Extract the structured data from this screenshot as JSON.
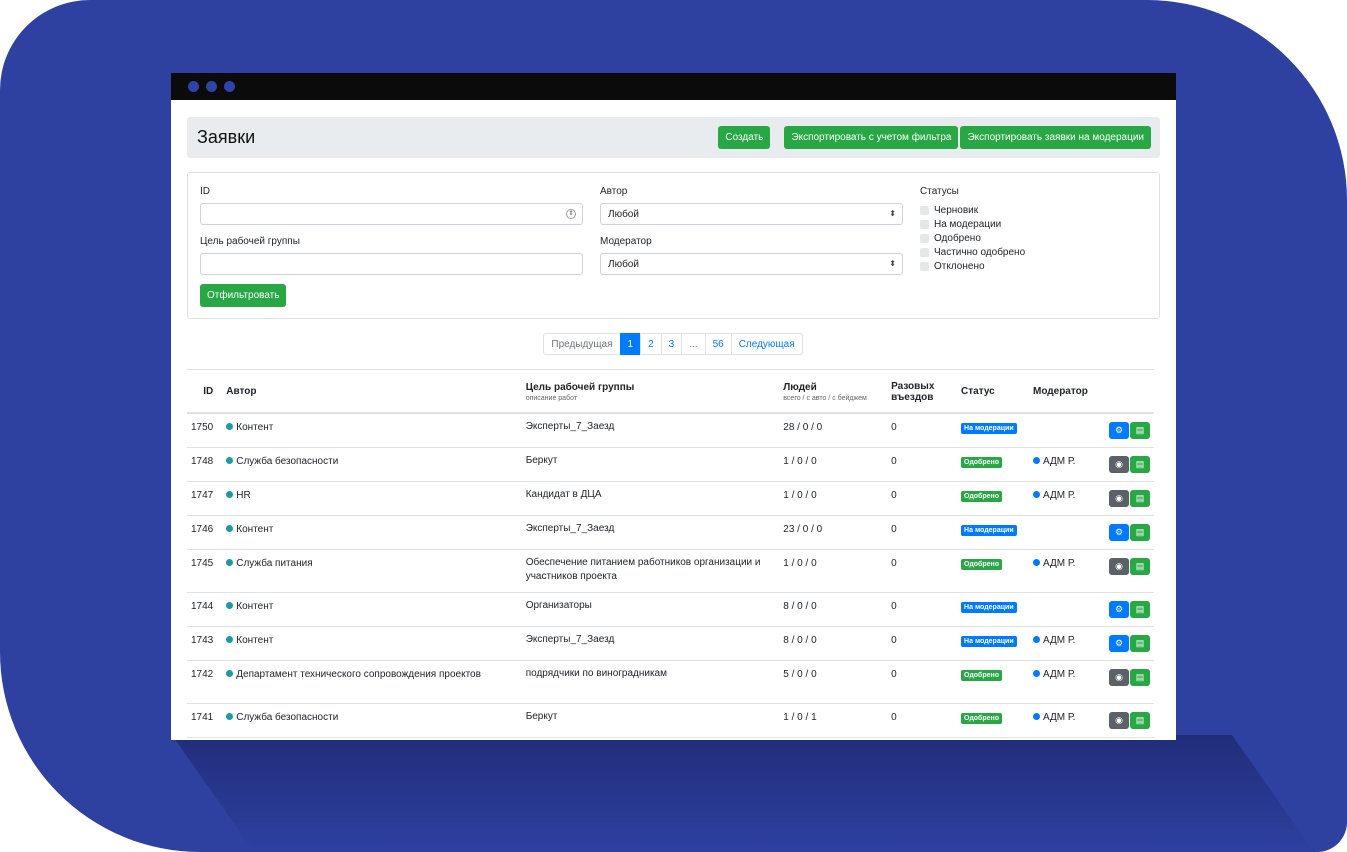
{
  "page": {
    "title": "Заявки",
    "buttons": {
      "create": "Создать",
      "export_filter": "Экспортировать с учетом фильтра",
      "export_moderation": "Экспортировать заявки на модерации"
    }
  },
  "filter": {
    "id_label": "ID",
    "id_value": "",
    "goal_label": "Цель рабочей группы",
    "goal_value": "",
    "author_label": "Автор",
    "author_value": "Любой",
    "moderator_label": "Модератор",
    "moderator_value": "Любой",
    "statuses_label": "Статусы",
    "statuses": [
      "Черновик",
      "На модерации",
      "Одобрено",
      "Частично одобрено",
      "Отклонено"
    ],
    "submit": "Отфильтровать"
  },
  "pagination": {
    "prev": "Предыдущая",
    "pages": [
      "1",
      "2",
      "3",
      "...",
      "56"
    ],
    "active": "1",
    "next": "Следующая"
  },
  "table": {
    "headers": {
      "id": "ID",
      "author": "Автор",
      "goal": "Цель рабочей группы",
      "goal_sub": "описание работ",
      "people": "Людей",
      "people_sub": "всего / с авто / с бейджем",
      "single": "Разовых въездов",
      "status": "Статус",
      "moderator": "Модератор"
    },
    "rows": [
      {
        "id": "1750",
        "author": "Контент",
        "goal": "Эксперты_7_Заезд",
        "people": "28 / 0 / 0",
        "single": "0",
        "status": "На модерации",
        "moderator": ""
      },
      {
        "id": "1748",
        "author": "Служба безопасности",
        "goal": "Беркут",
        "people": "1 / 0 / 0",
        "single": "0",
        "status": "Одобрено",
        "moderator": "АДМ Р."
      },
      {
        "id": "1747",
        "author": "HR",
        "goal": "Кандидат в ДЦА",
        "people": "1 / 0 / 0",
        "single": "0",
        "status": "Одобрено",
        "moderator": "АДМ Р."
      },
      {
        "id": "1746",
        "author": "Контент",
        "goal": "Эксперты_7_Заезд",
        "people": "23 / 0 / 0",
        "single": "0",
        "status": "На модерации",
        "moderator": ""
      },
      {
        "id": "1745",
        "author": "Служба питания",
        "goal": "Обеспечение питанием работников организации и участников проекта",
        "people": "1 / 0 / 0",
        "single": "0",
        "status": "Одобрено",
        "moderator": "АДМ Р."
      },
      {
        "id": "1744",
        "author": "Контент",
        "goal": "Организаторы",
        "people": "8 / 0 / 0",
        "single": "0",
        "status": "На модерации",
        "moderator": ""
      },
      {
        "id": "1743",
        "author": "Контент",
        "goal": "Эксперты_7_Заезд",
        "people": "8 / 0 / 0",
        "single": "0",
        "status": "На модерации",
        "moderator": "АДМ Р."
      },
      {
        "id": "1742",
        "author": "Департамент технического сопровождения проектов",
        "goal": "подрядчики по виноградникам",
        "people": "5 / 0 / 0",
        "single": "0",
        "status": "Одобрено",
        "moderator": "АДМ Р."
      },
      {
        "id": "1741",
        "author": "Служба безопасности",
        "goal": "Беркут",
        "people": "1 / 0 / 1",
        "single": "0",
        "status": "Одобрено",
        "moderator": "АДМ Р."
      }
    ]
  },
  "colors": {
    "background": "#2e40a0",
    "primary": "#007bff",
    "success": "#28a745",
    "secondary": "#5a6268"
  },
  "icons": {
    "moderate": "gears-icon",
    "view": "eye-icon",
    "document": "document-icon"
  }
}
